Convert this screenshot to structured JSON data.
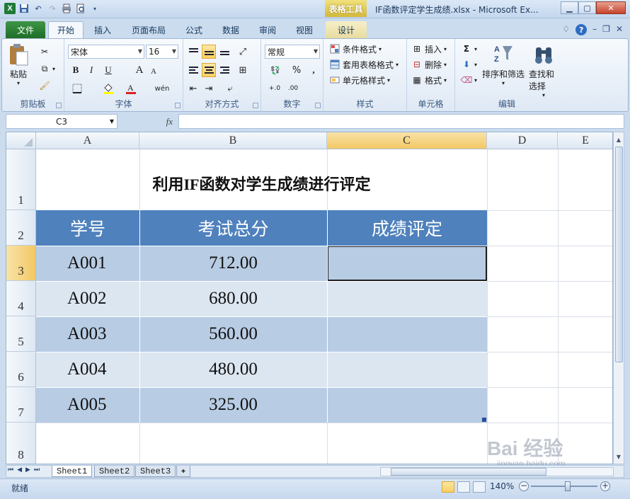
{
  "window": {
    "title": "IF函数评定学生成绩.xlsx - Microsoft Ex...",
    "context_tools": "表格工具",
    "logo": "X"
  },
  "tabs": [
    "文件",
    "开始",
    "插入",
    "页面布局",
    "公式",
    "数据",
    "审阅",
    "视图",
    "设计"
  ],
  "active_tab": "开始",
  "ribbon": {
    "clipboard": {
      "label": "剪贴板",
      "paste": "粘贴"
    },
    "font": {
      "label": "字体",
      "name": "宋体",
      "size": "16",
      "bold": "B",
      "italic": "I",
      "underline": "U",
      "grow": "A",
      "shrink": "A"
    },
    "align": {
      "label": "对齐方式"
    },
    "number": {
      "label": "数字",
      "format": "常规",
      "percent": "%",
      "comma": ",",
      "inc": "+.0",
      "dec": ".00"
    },
    "styles": {
      "label": "样式",
      "cond": "条件格式",
      "table": "套用表格格式",
      "cell": "单元格样式"
    },
    "cells": {
      "label": "单元格",
      "insert": "插入",
      "delete": "删除",
      "format": "格式"
    },
    "editing": {
      "label": "编辑",
      "sigma": "Σ",
      "sort": "排序和筛选",
      "find": "查找和选择"
    }
  },
  "formula_bar": {
    "name_box": "C3",
    "fx": "fx",
    "value": ""
  },
  "columns": [
    "A",
    "B",
    "C",
    "D",
    "E"
  ],
  "rows": [
    "1",
    "2",
    "3",
    "4",
    "5",
    "6",
    "7",
    "8"
  ],
  "sheet": {
    "title": "利用IF函数对学生成绩进行评定",
    "headers": [
      "学号",
      "考试总分",
      "成绩评定"
    ],
    "data": [
      {
        "id": "A001",
        "score": "712.00",
        "grade": ""
      },
      {
        "id": "A002",
        "score": "680.00",
        "grade": ""
      },
      {
        "id": "A003",
        "score": "560.00",
        "grade": ""
      },
      {
        "id": "A004",
        "score": "480.00",
        "grade": ""
      },
      {
        "id": "A005",
        "score": "325.00",
        "grade": ""
      }
    ]
  },
  "sheet_tabs": [
    "Sheet1",
    "Sheet2",
    "Sheet3"
  ],
  "status": {
    "ready": "就绪",
    "zoom": "140%"
  },
  "watermark": {
    "main": "Bai 经验",
    "sub": "jingyan.baidu.com"
  },
  "colors": {
    "header_fill": "#4f81bd",
    "band_dark": "#b8cce4",
    "band_light": "#dce6f1",
    "file_tab": "#2a8035"
  }
}
